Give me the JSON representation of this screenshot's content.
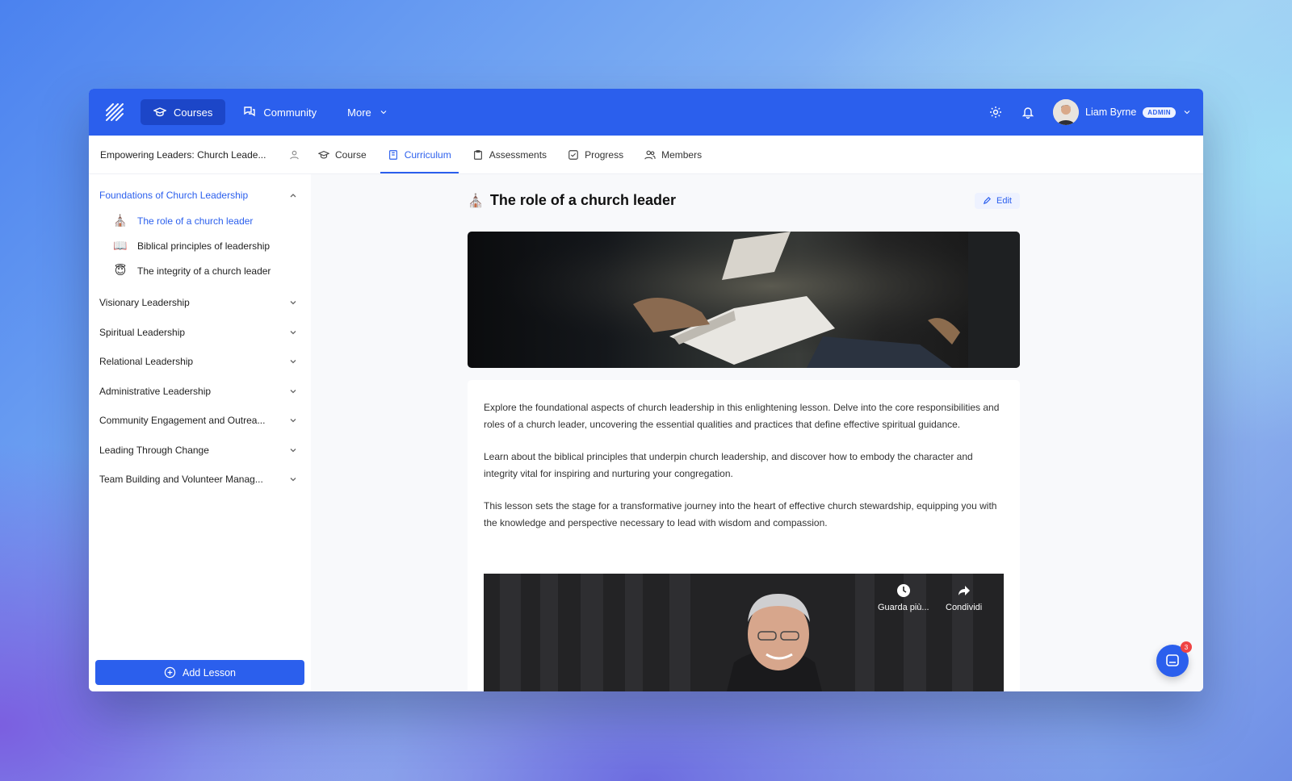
{
  "nav": {
    "courses": "Courses",
    "community": "Community",
    "more": "More",
    "user_name": "Liam Byrne",
    "user_badge": "ADMIN"
  },
  "subbar": {
    "course_title": "Empowering Leaders: Church Leade...",
    "tabs": [
      {
        "label": "Course"
      },
      {
        "label": "Curriculum"
      },
      {
        "label": "Assessments"
      },
      {
        "label": "Progress"
      },
      {
        "label": "Members"
      }
    ]
  },
  "sidebar": {
    "open_section": "Foundations of Church Leadership",
    "lessons": [
      {
        "icon": "⛪",
        "label": "The role of a church leader"
      },
      {
        "icon": "📖",
        "label": "Biblical principles of leadership"
      },
      {
        "icon": "😇",
        "label": "The integrity of a church leader"
      }
    ],
    "sections": [
      "Visionary Leadership",
      "Spiritual Leadership",
      "Relational Leadership",
      "Administrative Leadership",
      "Community Engagement and Outrea...",
      "Leading Through Change",
      "Team Building and Volunteer Manag..."
    ],
    "add_lesson": "Add Lesson"
  },
  "lesson": {
    "icon": "⛪",
    "title": "The role of a church leader",
    "edit": "Edit",
    "paragraphs": [
      "Explore the foundational aspects of church leadership in this enlightening lesson. Delve into the core responsibilities and roles of a church leader, uncovering the essential qualities and practices that define effective spiritual guidance.",
      "Learn about the biblical principles that underpin church leadership, and discover how to embody the character and integrity vital for inspiring and nurturing your congregation.",
      "This lesson sets the stage for a transformative journey into the heart of effective church stewardship, equipping you with the knowledge and perspective necessary to lead with wisdom and compassion."
    ],
    "video": {
      "watch_later": "Guarda più...",
      "share": "Condividi"
    }
  },
  "chat": {
    "badge": "3"
  },
  "colors": {
    "accent": "#2b5fed",
    "accent_dark": "#1c46c8",
    "badge": "#ef4444"
  }
}
